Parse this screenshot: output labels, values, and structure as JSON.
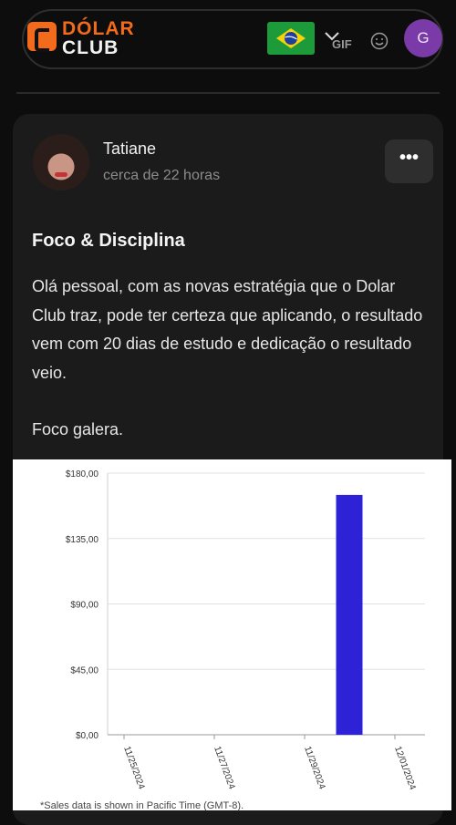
{
  "header": {
    "logo_line1": "DÓLAR",
    "logo_line2": "CLUB",
    "flag_icon": "brazil-flag-icon",
    "gif_label": "GIF",
    "user_initial": "G",
    "avatar_color": "#7a3aa8",
    "accent_color": "#f26a1b"
  },
  "post": {
    "author": "Tatiane",
    "time": "cerca de 22 horas",
    "more_label": "•••",
    "title": "Foco & Disciplina",
    "body": [
      "Olá pessoal, com as novas estratégia que o Dolar Club traz, pode ter certeza que aplicando, o resultado vem com 20 dias de estudo e dedicação o resultado veio.",
      "Foco galera."
    ]
  },
  "chart_data": {
    "type": "bar",
    "categories": [
      "11/25/2024",
      "11/27/2024",
      "11/29/2024",
      "12/01/2024"
    ],
    "bars": [
      {
        "x": "11/30/2024",
        "value": 165
      }
    ],
    "ylim": [
      0,
      180
    ],
    "yticks": [
      "$180,00",
      "$135,00",
      "$90,00",
      "$45,00",
      "$0,00"
    ],
    "ytick_values": [
      180,
      135,
      90,
      45,
      0
    ],
    "bar_color": "#2d22d6",
    "grid": true,
    "note": "*Sales data is shown in Pacific Time (GMT-8)."
  }
}
